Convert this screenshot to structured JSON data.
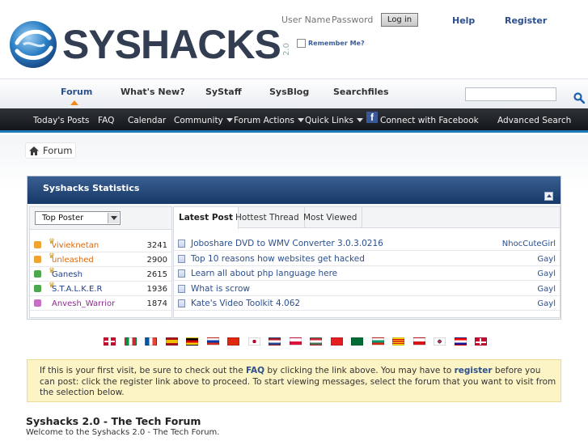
{
  "header": {
    "logo_text": "SYSHACKS",
    "logo_version": "2.0",
    "username_placeholder": "User Name",
    "password_placeholder": "Password",
    "login_label": "Log in",
    "remember_label": "Remember Me?",
    "help_label": "Help",
    "register_label": "Register"
  },
  "nav": {
    "tabs": [
      "Forum",
      "What's New?",
      "SyStaff",
      "SysBlog",
      "Searchfiles"
    ],
    "active": "Forum"
  },
  "subnav": {
    "items": [
      "Today's Posts",
      "FAQ",
      "Calendar",
      "Community",
      "Forum Actions",
      "Quick Links",
      "Connect with Facebook",
      "Advanced Search"
    ]
  },
  "breadcrumb": {
    "label": "Forum"
  },
  "stats": {
    "title": "Syshacks Statistics",
    "select_value": "Top Poster",
    "posters": [
      {
        "name": "vivieknetan",
        "count": "3241",
        "color": "#d66a12",
        "icon_color": "#f0a330",
        "crown": true
      },
      {
        "name": "unleashed",
        "count": "2900",
        "color": "#d66a12",
        "icon_color": "#f0a330",
        "crown": true
      },
      {
        "name": "Ganesh",
        "count": "2615",
        "color": "#1e3f8c",
        "icon_color": "#4ca84c",
        "crown": true
      },
      {
        "name": "S.T.A.L.K.E.R",
        "count": "1936",
        "color": "#1e3f8c",
        "icon_color": "#4ca84c",
        "crown": true
      },
      {
        "name": "Anvesh_Warrior",
        "count": "1874",
        "color": "#8a2d8e",
        "icon_color": "#c66fc8",
        "crown": false
      }
    ],
    "tabs": [
      "Latest Post",
      "Hottest Thread",
      "Most Viewed"
    ],
    "posts": [
      {
        "title": "Joboshare DVD to WMV Converter 3.0.3.0216",
        "user": "NhocCuteGirl"
      },
      {
        "title": "Top 10 reasons how websites get hacked",
        "user": "Gayl"
      },
      {
        "title": "Learn all about php language here",
        "user": "Gayl"
      },
      {
        "title": "What is scrow",
        "user": "Gayl"
      },
      {
        "title": "Kate's Video Toolkit 4.062",
        "user": "Gayl"
      }
    ]
  },
  "flags": [
    "uk",
    "italy",
    "france",
    "spain",
    "germany",
    "russia",
    "china",
    "japan",
    "netherlands",
    "poland",
    "hungary",
    "albania",
    "saudi",
    "bulgaria",
    "catalonia",
    "czech",
    "korea",
    "croatia",
    "denmark"
  ],
  "notice": {
    "p1": "If this is your first visit, be sure to check out the ",
    "faq": "FAQ",
    "p2": " by clicking the link above. You may have to ",
    "register": "register",
    "p3": " before you can post: click the register link above to proceed. To start viewing messages, select the forum that you want to visit from the selection below."
  },
  "forum": {
    "title": "Syshacks 2.0 - The Tech Forum",
    "description": "Welcome to the Syshacks 2.0 - The Tech Forum."
  }
}
